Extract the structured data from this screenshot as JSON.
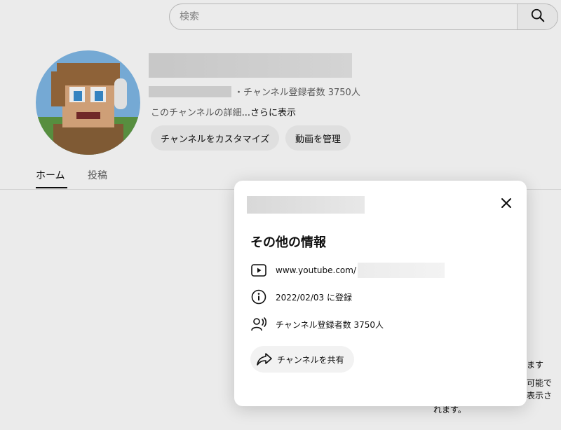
{
  "search": {
    "placeholder": "検索"
  },
  "channel": {
    "subscribers_text": "・チャンネル登録者数 3750人",
    "description": "このチャンネルの詳細",
    "more_link": " ...さらに表示",
    "customize_label": "チャンネルをカスタマイズ",
    "manage_label": "動画を管理"
  },
  "tabs": [
    {
      "label": "ホーム",
      "active": true
    },
    {
      "label": "投稿",
      "active": false
    }
  ],
  "background_text": {
    "line1": "ます",
    "line2": "可能で",
    "line3": "表示さ",
    "line4": "れます。"
  },
  "dialog": {
    "section_title": "その他の情報",
    "url_prefix": "www.youtube.com/",
    "joined": "2022/02/03 に登録",
    "subscribers": "チャンネル登録者数 3750人",
    "share_label": "チャンネルを共有"
  },
  "icons": {
    "search": "search-icon",
    "close": "close-icon",
    "play": "play-icon",
    "info": "info-icon",
    "person": "person-icon",
    "share": "share-icon"
  }
}
